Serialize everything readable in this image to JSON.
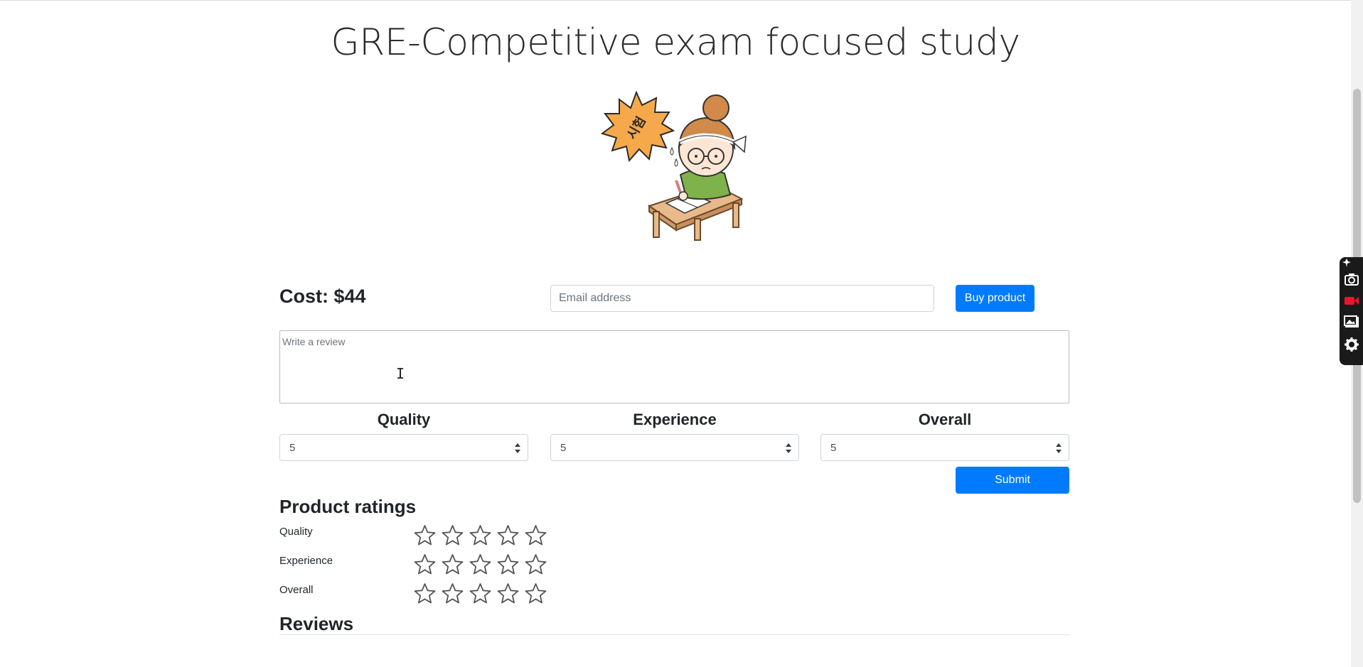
{
  "page": {
    "title": "GRE-Competitive exam focused study",
    "illustration": "studying-girl-illustration",
    "burst_text": "시험"
  },
  "purchase": {
    "cost": "Cost: $44",
    "email_placeholder": "Email address",
    "buy_label": "Buy product"
  },
  "review_form": {
    "placeholder": "Write a review",
    "columns": [
      {
        "label": "Quality",
        "selected": "5"
      },
      {
        "label": "Experience",
        "selected": "5"
      },
      {
        "label": "Overall",
        "selected": "5"
      }
    ],
    "submit_label": "Submit"
  },
  "ratings": {
    "heading": "Product ratings",
    "rows": [
      {
        "label": "Quality",
        "stars_filled": 0,
        "stars_max": 5
      },
      {
        "label": "Experience",
        "stars_filled": 0,
        "stars_max": 5
      },
      {
        "label": "Overall",
        "stars_filled": 0,
        "stars_max": 5
      }
    ]
  },
  "reviews": {
    "heading": "Reviews"
  },
  "colors": {
    "primary": "#007bff",
    "star_outline": "#555555",
    "text": "#212529"
  },
  "side_dock": {
    "icons": [
      "pin-icon",
      "camera-icon",
      "record-video-icon",
      "gallery-icon",
      "gear-icon"
    ]
  }
}
